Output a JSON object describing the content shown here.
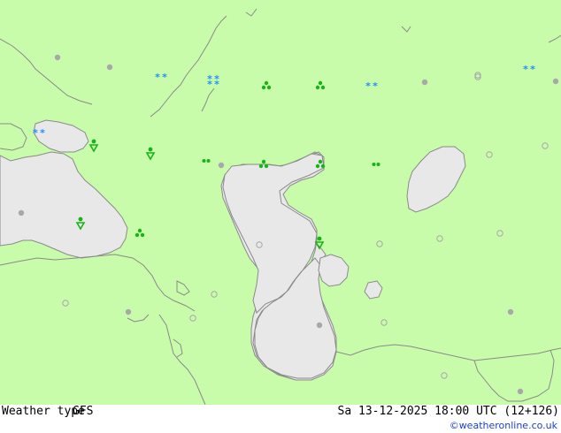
{
  "map": {
    "land_color": "#c8fcaa",
    "sea_color": "#e8e8e8",
    "border_color": "#8a8a8a",
    "snow_color": "#1e90ff",
    "rain_color": "#19b319",
    "regions": [
      {
        "name": "black-sea"
      },
      {
        "name": "sea-of-azov"
      },
      {
        "name": "caspian-sea"
      },
      {
        "name": "aral-sea"
      },
      {
        "name": "lake-sarygamysh"
      }
    ],
    "symbols": [
      {
        "type": "snow-icon",
        "color": "snow"
      },
      {
        "type": "snow-icon",
        "color": "snow"
      },
      {
        "type": "snow-icon",
        "color": "snow"
      },
      {
        "type": "snow-icon",
        "color": "snow"
      },
      {
        "type": "snow-showers-icon",
        "color": "snow"
      },
      {
        "type": "rain-showers-icon",
        "color": "rain"
      },
      {
        "type": "rain-showers-icon",
        "color": "rain"
      },
      {
        "type": "rain-showers-icon",
        "color": "rain"
      },
      {
        "type": "rain-showers-icon",
        "color": "rain"
      },
      {
        "type": "rain-showers-icon",
        "color": "rain"
      },
      {
        "type": "light-rain-icon",
        "color": "rain"
      },
      {
        "type": "light-rain-icon",
        "color": "rain"
      },
      {
        "type": "light-rain-icon",
        "color": "rain"
      },
      {
        "type": "light-rain-icon",
        "color": "rain"
      },
      {
        "type": "drizzle-icon",
        "color": "rain"
      },
      {
        "type": "drizzle-icon",
        "color": "rain"
      },
      {
        "type": "overcast-dot-icon",
        "color": "gray"
      },
      {
        "type": "cloudy-ring-icon",
        "color": "gray"
      }
    ]
  },
  "footer": {
    "product": "Weather type",
    "model": "GFS",
    "valid_time": "Sa 13-12-2025 18:00 UTC (12+126)",
    "credit": "©weatheronline.co.uk"
  }
}
